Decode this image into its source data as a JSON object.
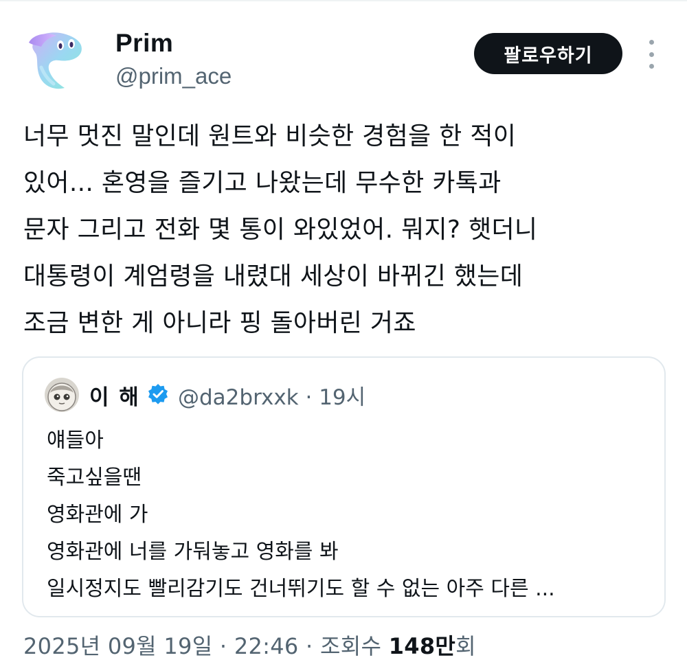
{
  "author": {
    "display_name": "Prim",
    "handle": "@prim_ace"
  },
  "actions": {
    "follow_label": "팔로우하기",
    "more_icon": "more-vertical-icon"
  },
  "tweet": {
    "lines": [
      "너무 멋진 말인데 원트와 비슷한 경험을 한 적이",
      "있어... 혼영을 즐기고 나왔는데 무수한 카톡과",
      "문자 그리고 전화 몇 통이 와있었어. 뭐지? 햇더니",
      "대통령이 계엄령을 내렸대 세상이 바뀌긴 했는데",
      "조금 변한 게 아니라 핑 돌아버린 거죠"
    ]
  },
  "quote": {
    "display_name": "이 해",
    "verified": true,
    "verified_color": "#1d9bf0",
    "handle_time": "@da2brxxk · 19시",
    "lines": [
      "얘들아",
      "죽고싶을땐",
      "영화관에 가",
      "영화관에 너를 가둬놓고 영화를 봐",
      "일시정지도 빨리감기도 건너뛰기도 할 수 없는 아주 다른 ..."
    ]
  },
  "meta": {
    "date_time": "2025년 09월 19일 · 22:46 · 조회수 ",
    "views": "148만",
    "views_suffix": "회"
  }
}
